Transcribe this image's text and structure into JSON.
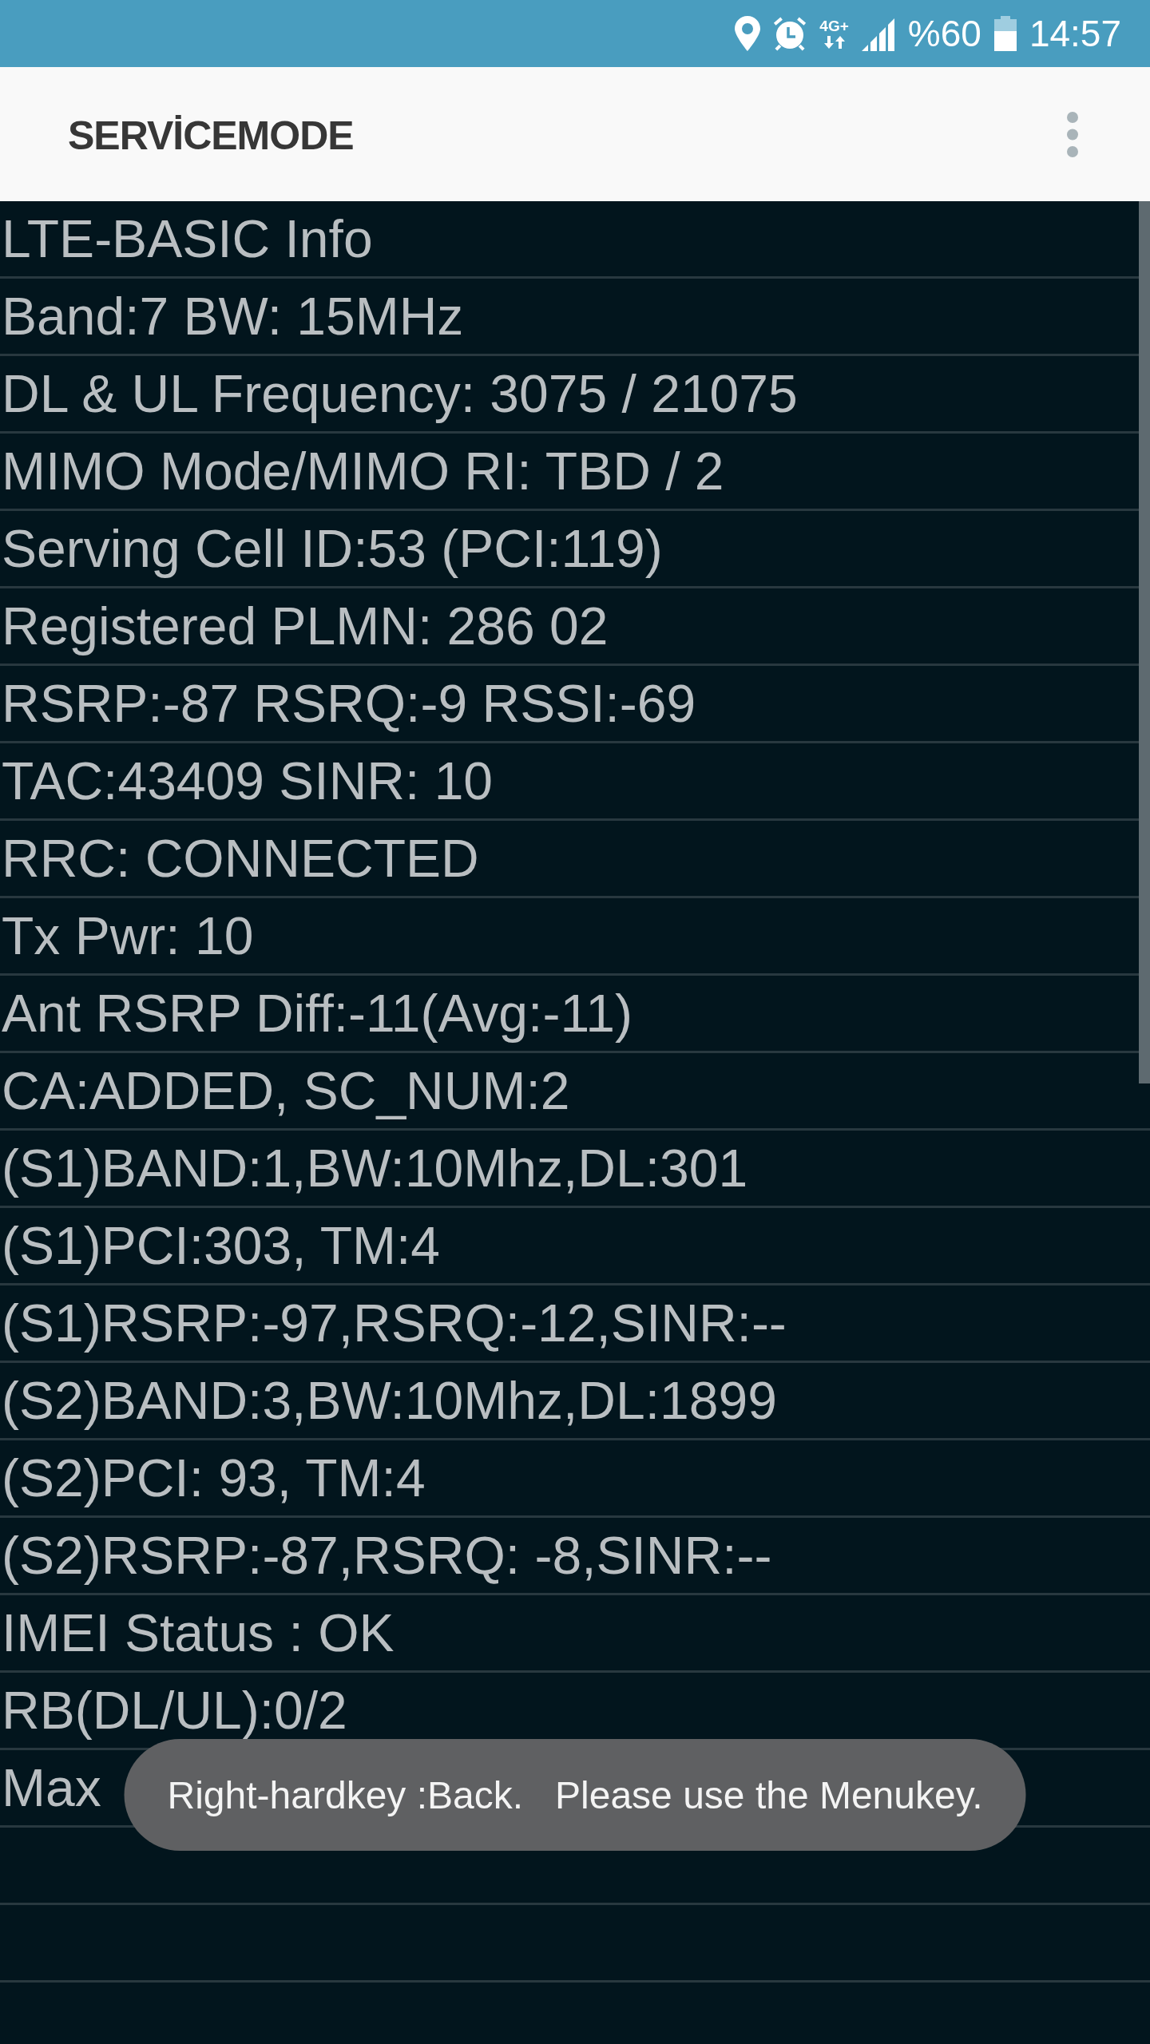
{
  "status_bar": {
    "network_type": "4G+",
    "battery": "%60",
    "time": "14:57"
  },
  "app_bar": {
    "title": "SERVİCEMODE"
  },
  "info_rows": [
    "LTE-BASIC Info",
    "Band:7 BW: 15MHz",
    "DL & UL Frequency: 3075 / 21075",
    "MIMO Mode/MIMO RI: TBD / 2",
    "Serving Cell ID:53 (PCI:119)",
    "Registered PLMN: 286 02",
    "RSRP:-87 RSRQ:-9 RSSI:-69",
    "TAC:43409 SINR: 10",
    "RRC: CONNECTED",
    "Tx Pwr: 10",
    "Ant RSRP Diff:-11(Avg:-11)",
    "CA:ADDED, SC_NUM:2",
    "(S1)BAND:1,BW:10Mhz,DL:301",
    "(S1)PCI:303, TM:4",
    "(S1)RSRP:-97,RSRQ:-12,SINR:--",
    "(S2)BAND:3,BW:10Mhz,DL:1899",
    "(S2)PCI: 93, TM:4",
    "(S2)RSRP:-87,RSRQ: -8,SINR:--",
    "IMEI Status : OK",
    "RB(DL/UL):0/2",
    "Max"
  ],
  "toast": {
    "message": "Right-hardkey :Back.   Please use the Menukey."
  }
}
